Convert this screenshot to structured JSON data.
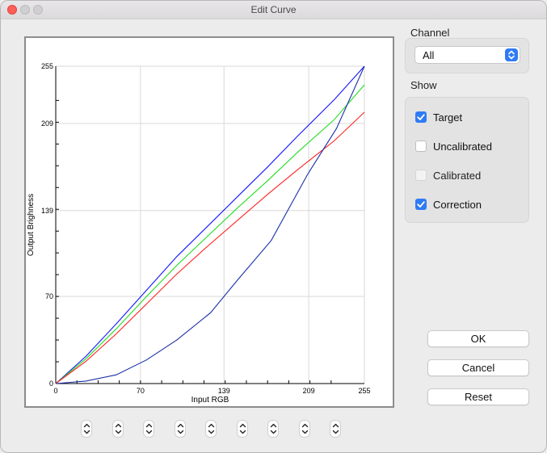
{
  "window": {
    "title": "Edit Curve"
  },
  "channel": {
    "label": "Channel",
    "selected": "All"
  },
  "show": {
    "label": "Show",
    "options": [
      {
        "label": "Target",
        "checked": true,
        "enabled": true
      },
      {
        "label": "Uncalibrated",
        "checked": false,
        "enabled": true
      },
      {
        "label": "Calibrated",
        "checked": false,
        "enabled": false
      },
      {
        "label": "Correction",
        "checked": true,
        "enabled": true
      }
    ]
  },
  "buttons": {
    "ok": "OK",
    "cancel": "Cancel",
    "reset": "Reset"
  },
  "chart_data": {
    "type": "line",
    "xlabel": "Input RGB",
    "ylabel": "Output Brighness",
    "xlim": [
      0,
      255
    ],
    "ylim": [
      0,
      255
    ],
    "xticks": [
      "0",
      "70",
      "139",
      "209",
      "255"
    ],
    "yticks": [
      "0",
      "70",
      "139",
      "209",
      "255"
    ],
    "grid": true,
    "series": [
      {
        "color": "#1515ff",
        "points": [
          [
            0,
            0
          ],
          [
            25,
            22
          ],
          [
            50,
            48
          ],
          [
            75,
            75
          ],
          [
            100,
            102
          ],
          [
            125,
            126
          ],
          [
            150,
            150
          ],
          [
            175,
            174
          ],
          [
            200,
            199
          ],
          [
            230,
            228
          ],
          [
            255,
            255
          ]
        ]
      },
      {
        "color": "#22dd22",
        "points": [
          [
            0,
            0
          ],
          [
            25,
            20
          ],
          [
            50,
            44
          ],
          [
            75,
            70
          ],
          [
            100,
            95
          ],
          [
            125,
            118
          ],
          [
            150,
            141
          ],
          [
            175,
            163
          ],
          [
            200,
            186
          ],
          [
            230,
            212
          ],
          [
            255,
            240
          ]
        ]
      },
      {
        "color": "#ff2222",
        "points": [
          [
            0,
            0
          ],
          [
            25,
            18
          ],
          [
            50,
            40
          ],
          [
            75,
            64
          ],
          [
            100,
            88
          ],
          [
            125,
            110
          ],
          [
            150,
            131
          ],
          [
            175,
            152
          ],
          [
            200,
            172
          ],
          [
            230,
            195
          ],
          [
            255,
            218
          ]
        ]
      },
      {
        "color": "#1a2fa8",
        "points": [
          [
            0,
            0
          ],
          [
            25,
            2
          ],
          [
            50,
            7
          ],
          [
            75,
            19
          ],
          [
            100,
            35
          ],
          [
            128,
            57
          ],
          [
            150,
            83
          ],
          [
            178,
            115
          ],
          [
            208,
            168
          ],
          [
            232,
            205
          ],
          [
            255,
            255
          ]
        ]
      }
    ]
  },
  "steppers": {
    "count": 9,
    "icon": "up-down-chevron-icon"
  }
}
